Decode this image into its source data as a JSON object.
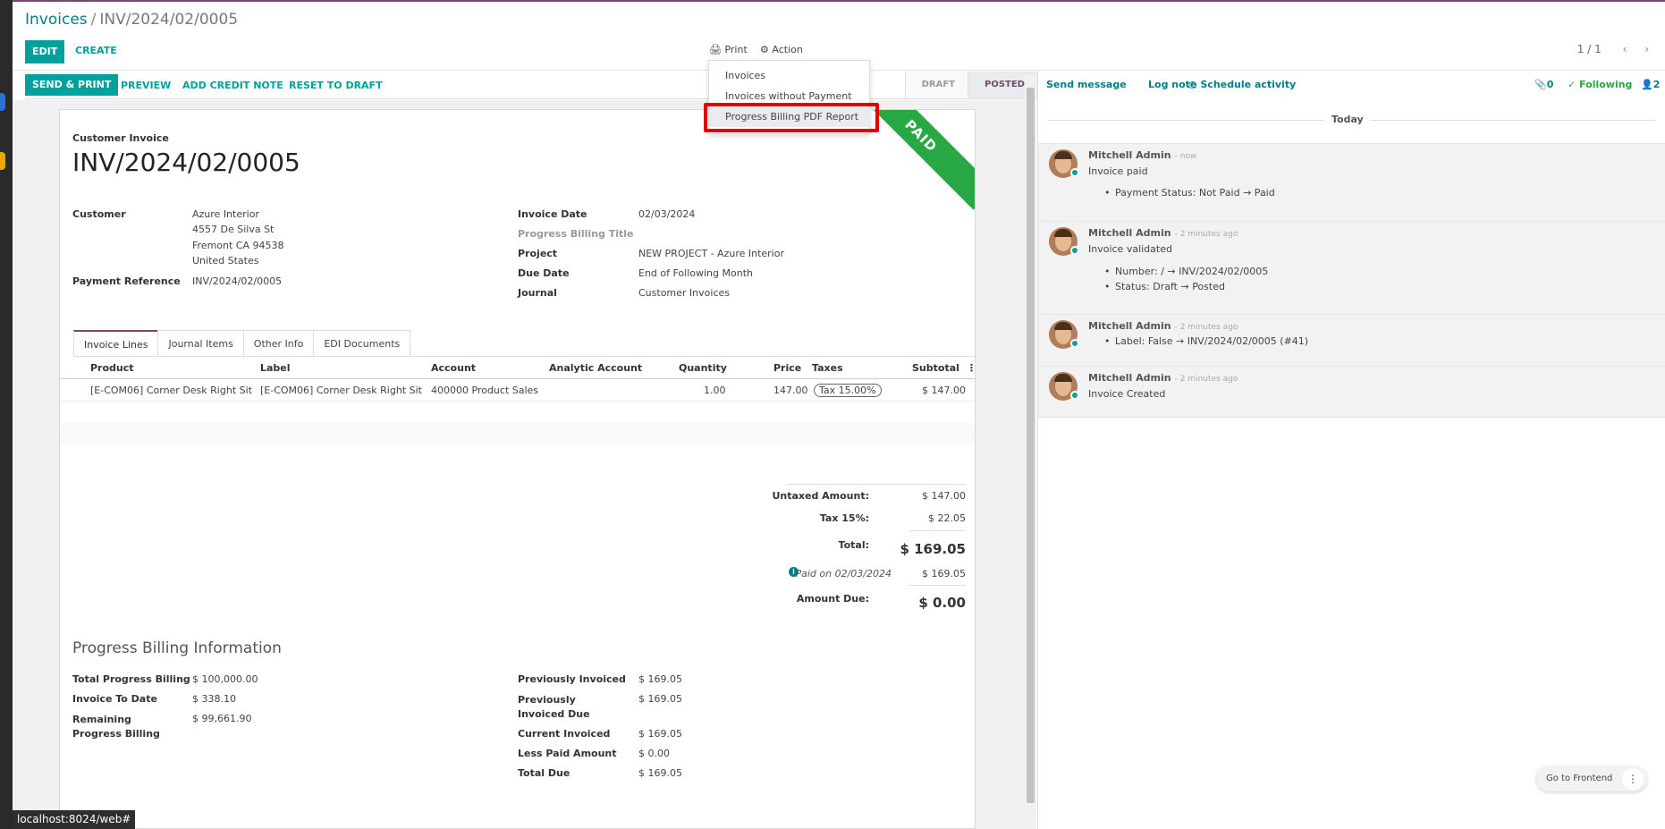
{
  "breadcrumb": {
    "parent": "Invoices",
    "separator": "/",
    "current": "INV/2024/02/0005"
  },
  "control": {
    "edit": "EDIT",
    "create": "CREATE",
    "print": "Print",
    "action": "Action",
    "pager": "1 / 1"
  },
  "print_menu": {
    "items": [
      "Invoices",
      "Invoices without Payment",
      "Progress Billing PDF Report"
    ]
  },
  "statusbar": {
    "buttons": [
      "SEND & PRINT",
      "PREVIEW",
      "ADD CREDIT NOTE",
      "RESET TO DRAFT"
    ],
    "steps": [
      "DRAFT",
      "POSTED"
    ],
    "active_step": "POSTED"
  },
  "invoice": {
    "type": "Customer Invoice",
    "number": "INV/2024/02/0005",
    "ribbon": "PAID",
    "customer_label": "Customer",
    "customer_name": "Azure Interior",
    "address": [
      "4557 De Silva St",
      "Fremont CA 94538",
      "United States"
    ],
    "payment_ref_label": "Payment Reference",
    "payment_ref": "INV/2024/02/0005",
    "invoice_date_label": "Invoice Date",
    "invoice_date": "02/03/2024",
    "pb_title_label": "Progress Billing Title",
    "project_label": "Project",
    "project": "NEW PROJECT - Azure Interior",
    "due_date_label": "Due Date",
    "due_date": "End of Following Month",
    "journal_label": "Journal",
    "journal": "Customer Invoices"
  },
  "tabs": [
    "Invoice Lines",
    "Journal Items",
    "Other Info",
    "EDI Documents"
  ],
  "lines": {
    "headers": [
      "Product",
      "Label",
      "Account",
      "Analytic Account",
      "Quantity",
      "Price",
      "Taxes",
      "Subtotal"
    ],
    "rows": [
      {
        "product": "[E-COM06] Corner Desk Right Sit",
        "label": "[E-COM06] Corner Desk Right Sit",
        "account": "400000 Product Sales",
        "analytic": "",
        "quantity": "1.00",
        "price": "147.00",
        "taxes": "Tax 15.00%",
        "subtotal": "$ 147.00"
      }
    ]
  },
  "totals": {
    "untaxed_label": "Untaxed Amount:",
    "untaxed": "$ 147.00",
    "tax_label": "Tax 15%:",
    "tax": "$ 22.05",
    "total_label": "Total:",
    "total": "$ 169.05",
    "paid_on": "Paid on 02/03/2024",
    "paid_amount": "$ 169.05",
    "due_label": "Amount Due:",
    "due": "$ 0.00"
  },
  "progress": {
    "title": "Progress Billing Information",
    "left": [
      {
        "label": "Total Progress Billing",
        "value": "$ 100,000.00"
      },
      {
        "label": "Invoice To Date",
        "value": "$ 338.10"
      },
      {
        "label": "Remaining Progress Billing",
        "value": "$ 99,661.90"
      }
    ],
    "right": [
      {
        "label": "Previously Invoiced",
        "value": "$ 169.05"
      },
      {
        "label": "Previously Invoiced Due",
        "value": "$ 169.05"
      },
      {
        "label": "Current Invoiced",
        "value": "$ 169.05"
      },
      {
        "label": "Less Paid Amount",
        "value": "$ 0.00"
      },
      {
        "label": "Total Due",
        "value": "$ 169.05"
      }
    ]
  },
  "chatter": {
    "send_message": "Send message",
    "log_note": "Log note",
    "schedule": "Schedule activity",
    "attachments": "0",
    "following": "Following",
    "followers": "2",
    "today": "Today",
    "messages": [
      {
        "author": "Mitchell Admin",
        "time": "- now",
        "body": "Invoice paid",
        "bullets": [
          "Payment Status: Not Paid → Paid"
        ]
      },
      {
        "author": "Mitchell Admin",
        "time": "- 2 minutes ago",
        "body": "Invoice validated",
        "bullets": [
          "Number: / → INV/2024/02/0005",
          "Status: Draft → Posted"
        ]
      },
      {
        "author": "Mitchell Admin",
        "time": "- 2 minutes ago",
        "body": "",
        "bullets": [
          "Label: False → INV/2024/02/0005 (#41)"
        ]
      },
      {
        "author": "Mitchell Admin",
        "time": "- 2 minutes ago",
        "body": "Invoice Created",
        "bullets": []
      }
    ]
  },
  "footer": {
    "url": "localhost:8024/web#",
    "go_frontend": "Go to Frontend"
  },
  "colors": {
    "brand": "#714b67",
    "primary": "#00a09d",
    "link": "#017e84",
    "paid": "#28a745",
    "highlight": "#e00000"
  }
}
